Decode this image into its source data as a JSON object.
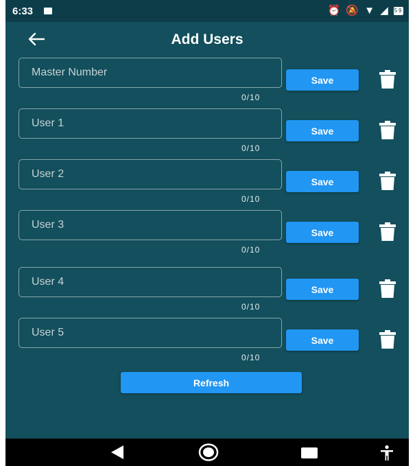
{
  "status_bar": {
    "time": "6:33",
    "battery_level": "59"
  },
  "header": {
    "title": "Add Users"
  },
  "rows": [
    {
      "placeholder": "Master Number",
      "value": "",
      "counter": "0/10",
      "save_label": "Save"
    },
    {
      "placeholder": "User 1",
      "value": "",
      "counter": "0/10",
      "save_label": "Save"
    },
    {
      "placeholder": "User 2",
      "value": "",
      "counter": "0/10",
      "save_label": "Save"
    },
    {
      "placeholder": "User 3",
      "value": "",
      "counter": "0/10",
      "save_label": "Save"
    },
    {
      "placeholder": "User 4",
      "value": "",
      "counter": "0/10",
      "save_label": "Save"
    },
    {
      "placeholder": "User 5",
      "value": "",
      "counter": "0/10",
      "save_label": "Save"
    }
  ],
  "refresh_label": "Refresh",
  "colors": {
    "background": "#134f5c",
    "status_bar": "#0e3d4a",
    "button": "#2196f3",
    "nav_bar": "#000000"
  },
  "icons": {
    "back": "arrow-left-icon",
    "delete": "trash-icon",
    "nav_back": "triangle-back-icon",
    "nav_home": "circle-home-icon",
    "nav_recents": "square-recents-icon",
    "accessibility": "accessibility-icon"
  }
}
